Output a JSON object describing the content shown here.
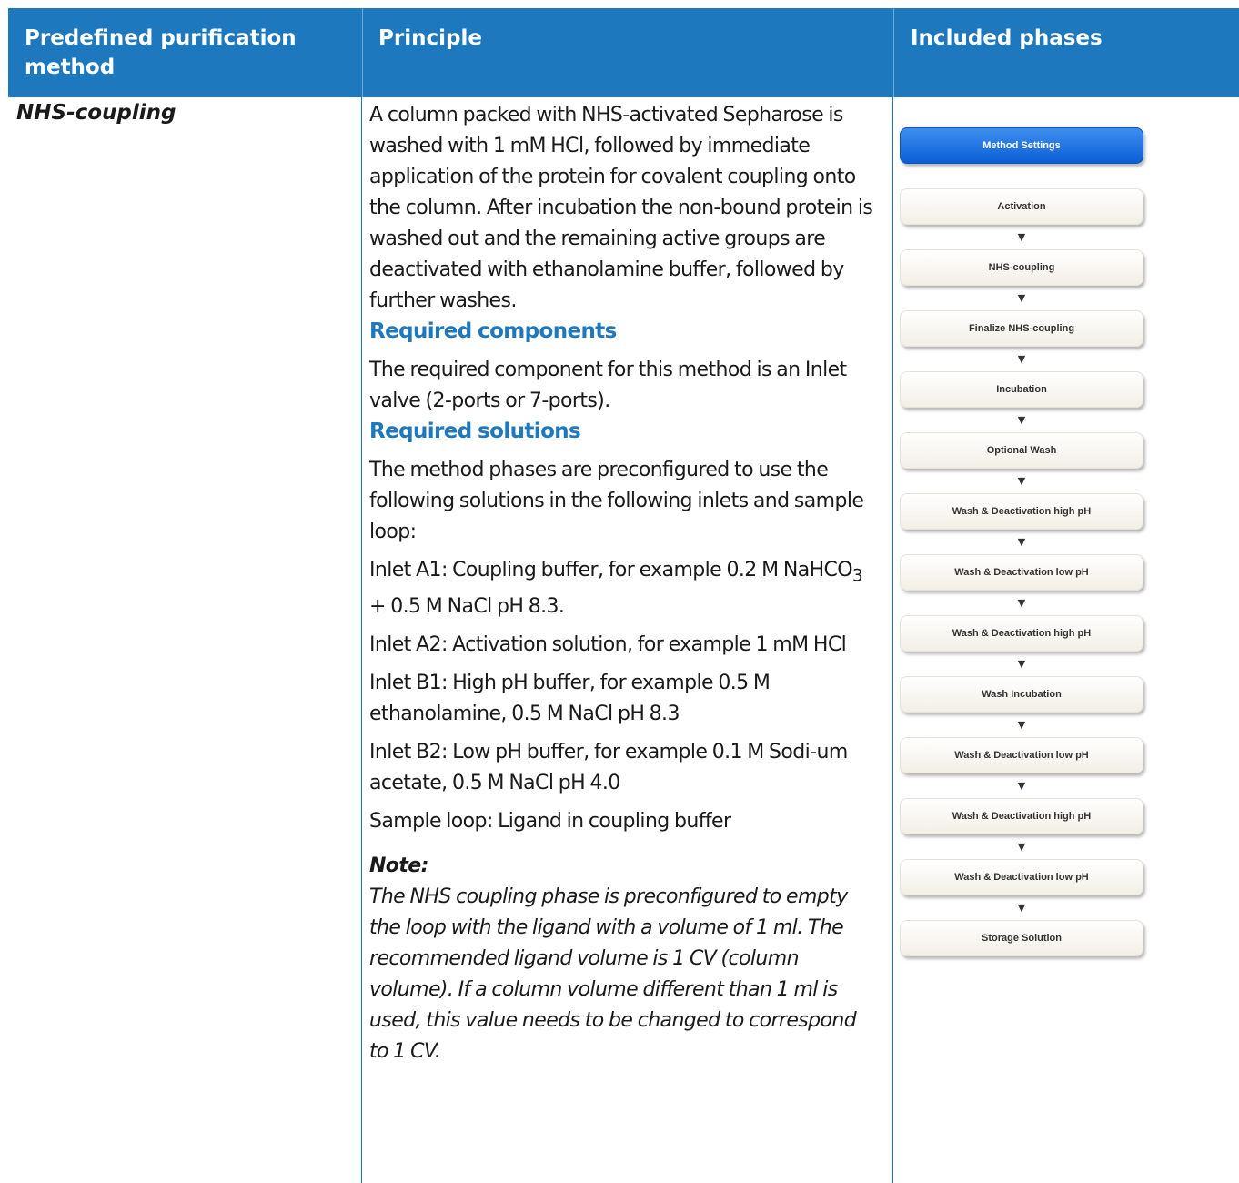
{
  "table": {
    "headers": {
      "method": "Predefined purification method",
      "principle": "Principle",
      "phases": "Included phases"
    },
    "row": {
      "method_name": "NHS-coupling",
      "principle": {
        "intro": "A column packed with NHS-activated Sepharose is washed with 1 mM HCl, followed by immediate application of the protein for covalent coupling onto the column. After incubation the non-bound protein is washed out and the remaining active groups are deactivated with ethanolamine buffer, followed by further washes.",
        "components_heading": "Required components",
        "components_text": "The required component for this method is an Inlet valve (2-ports or 7-ports).",
        "solutions_heading": "Required solutions",
        "solutions_text": "The method phases are preconfigured to use the following solutions in the following inlets and sample loop:",
        "inlet_a1_pre": "Inlet A1: Coupling buffer, for example 0.2 M NaHCO",
        "inlet_a1_sub": "3",
        "inlet_a1_post": " + 0.5 M NaCl pH 8.3.",
        "inlet_a2": "Inlet A2: Activation solution, for example 1 mM HCl",
        "inlet_b1": "Inlet B1: High pH buffer, for example 0.5 M ethanolamine, 0.5 M NaCl pH 8.3",
        "inlet_b2": "Inlet B2: Low pH buffer, for example 0.1 M Sodi-um acetate, 0.5 M NaCl pH 4.0",
        "sample_loop": "Sample loop: Ligand in coupling buffer",
        "note_label": "Note:",
        "note_text": "The NHS coupling phase is preconfigured to empty the loop with the ligand with a volume of 1 ml. The recommended ligand volume is 1 CV (column volume). If a column volume different than 1 ml is used, this value needs to be changed to correspond to 1 CV."
      },
      "phases": {
        "method_settings": "Method Settings",
        "arrow_glyph": "▼",
        "items": [
          "Activation",
          "NHS-coupling",
          "Finalize NHS-coupling",
          "Incubation",
          "Optional Wash",
          "Wash & Deactivation high pH",
          "Wash & Deactivation low pH",
          "Wash & Deactivation high pH",
          "Wash Incubation",
          "Wash & Deactivation low pH",
          "Wash & Deactivation high pH",
          "Wash & Deactivation low pH",
          "Storage Solution"
        ]
      }
    }
  },
  "colors": {
    "header_bg": "#1d78bd",
    "heading_blue": "#1d78bd",
    "settings_blue": "#0b5ed7"
  }
}
